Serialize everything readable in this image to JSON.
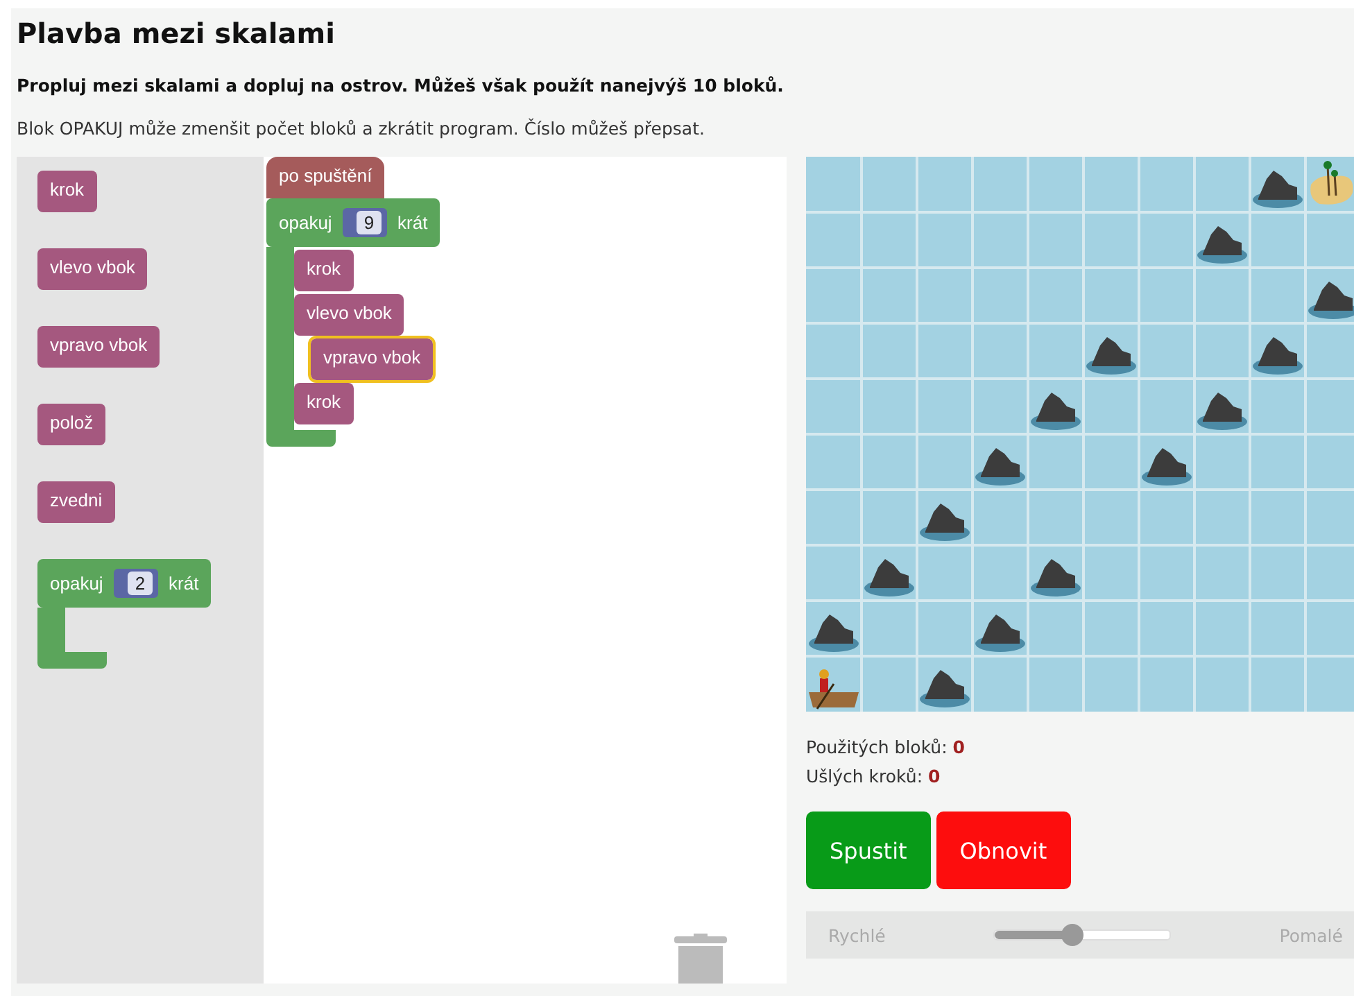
{
  "title": "Plavba mezi skalami",
  "task": "Propluj mezi skalami a dopluj na ostrov. Můžeš však použít nanejvýš 10 bloků.",
  "hint": "Blok OPAKUJ může zmenšit počet bloků a zkrátit program. Číslo můžeš přepsat.",
  "toolbox": [
    {
      "kind": "command",
      "label": "krok"
    },
    {
      "kind": "command",
      "label": "vlevo vbok"
    },
    {
      "kind": "command",
      "label": "vpravo vbok"
    },
    {
      "kind": "command",
      "label": "polož"
    },
    {
      "kind": "command",
      "label": "zvedni"
    },
    {
      "kind": "repeat",
      "label": "opakuj",
      "count": "2",
      "suffix": "krát"
    }
  ],
  "program": {
    "start": "po spuštění",
    "repeat": {
      "label": "opakuj",
      "count": "9",
      "suffix": "krát"
    },
    "body": [
      {
        "label": "krok",
        "selected": false
      },
      {
        "label": "vlevo vbok",
        "selected": false
      },
      {
        "label": "vpravo vbok",
        "selected": true
      },
      {
        "label": "krok",
        "selected": false
      }
    ]
  },
  "map": {
    "rows": [
      {
        "cells": [
          {
            "kind": "water"
          },
          {
            "kind": "water"
          },
          {
            "kind": "water"
          },
          {
            "kind": "water"
          },
          {
            "kind": "water"
          },
          {
            "kind": "water"
          },
          {
            "kind": "water"
          },
          {
            "kind": "water"
          },
          {
            "kind": "rock"
          },
          {
            "kind": "island"
          }
        ]
      },
      {
        "cells": [
          {
            "kind": "water"
          },
          {
            "kind": "water"
          },
          {
            "kind": "water"
          },
          {
            "kind": "water"
          },
          {
            "kind": "water"
          },
          {
            "kind": "water"
          },
          {
            "kind": "water"
          },
          {
            "kind": "rock"
          },
          {
            "kind": "water"
          },
          {
            "kind": "water"
          }
        ]
      },
      {
        "cells": [
          {
            "kind": "water"
          },
          {
            "kind": "water"
          },
          {
            "kind": "water"
          },
          {
            "kind": "water"
          },
          {
            "kind": "water"
          },
          {
            "kind": "water"
          },
          {
            "kind": "water"
          },
          {
            "kind": "water"
          },
          {
            "kind": "water"
          },
          {
            "kind": "rock"
          }
        ]
      },
      {
        "cells": [
          {
            "kind": "water"
          },
          {
            "kind": "water"
          },
          {
            "kind": "water"
          },
          {
            "kind": "water"
          },
          {
            "kind": "water"
          },
          {
            "kind": "rock"
          },
          {
            "kind": "water"
          },
          {
            "kind": "water"
          },
          {
            "kind": "rock"
          },
          {
            "kind": "water"
          }
        ]
      },
      {
        "cells": [
          {
            "kind": "water"
          },
          {
            "kind": "water"
          },
          {
            "kind": "water"
          },
          {
            "kind": "water"
          },
          {
            "kind": "rock"
          },
          {
            "kind": "water"
          },
          {
            "kind": "water"
          },
          {
            "kind": "rock"
          },
          {
            "kind": "water"
          },
          {
            "kind": "water"
          }
        ]
      },
      {
        "cells": [
          {
            "kind": "water"
          },
          {
            "kind": "water"
          },
          {
            "kind": "water"
          },
          {
            "kind": "rock"
          },
          {
            "kind": "water"
          },
          {
            "kind": "water"
          },
          {
            "kind": "rock"
          },
          {
            "kind": "water"
          },
          {
            "kind": "water"
          },
          {
            "kind": "water"
          }
        ]
      },
      {
        "cells": [
          {
            "kind": "water"
          },
          {
            "kind": "water"
          },
          {
            "kind": "rock"
          },
          {
            "kind": "water"
          },
          {
            "kind": "water"
          },
          {
            "kind": "water"
          },
          {
            "kind": "water"
          },
          {
            "kind": "water"
          },
          {
            "kind": "water"
          },
          {
            "kind": "water"
          }
        ]
      },
      {
        "cells": [
          {
            "kind": "water"
          },
          {
            "kind": "rock"
          },
          {
            "kind": "water"
          },
          {
            "kind": "water"
          },
          {
            "kind": "rock"
          },
          {
            "kind": "water"
          },
          {
            "kind": "water"
          },
          {
            "kind": "water"
          },
          {
            "kind": "water"
          },
          {
            "kind": "water"
          }
        ]
      },
      {
        "cells": [
          {
            "kind": "rock"
          },
          {
            "kind": "water"
          },
          {
            "kind": "water"
          },
          {
            "kind": "rock"
          },
          {
            "kind": "water"
          },
          {
            "kind": "water"
          },
          {
            "kind": "water"
          },
          {
            "kind": "water"
          },
          {
            "kind": "water"
          },
          {
            "kind": "water"
          }
        ]
      },
      {
        "cells": [
          {
            "kind": "boat"
          },
          {
            "kind": "water"
          },
          {
            "kind": "rock"
          },
          {
            "kind": "water"
          },
          {
            "kind": "water"
          },
          {
            "kind": "water"
          },
          {
            "kind": "water"
          },
          {
            "kind": "water"
          },
          {
            "kind": "water"
          },
          {
            "kind": "water"
          }
        ]
      }
    ]
  },
  "stats": [
    {
      "label": "Použitých bloků:",
      "value": "0"
    },
    {
      "label": "Ušlých kroků:",
      "value": "0"
    }
  ],
  "buttons": [
    {
      "kind": "run",
      "label": "Spustit"
    },
    {
      "kind": "reset",
      "label": "Obnovit"
    }
  ],
  "speed": {
    "fast": "Rychlé",
    "slow": "Pomalé",
    "level": 0.44
  }
}
